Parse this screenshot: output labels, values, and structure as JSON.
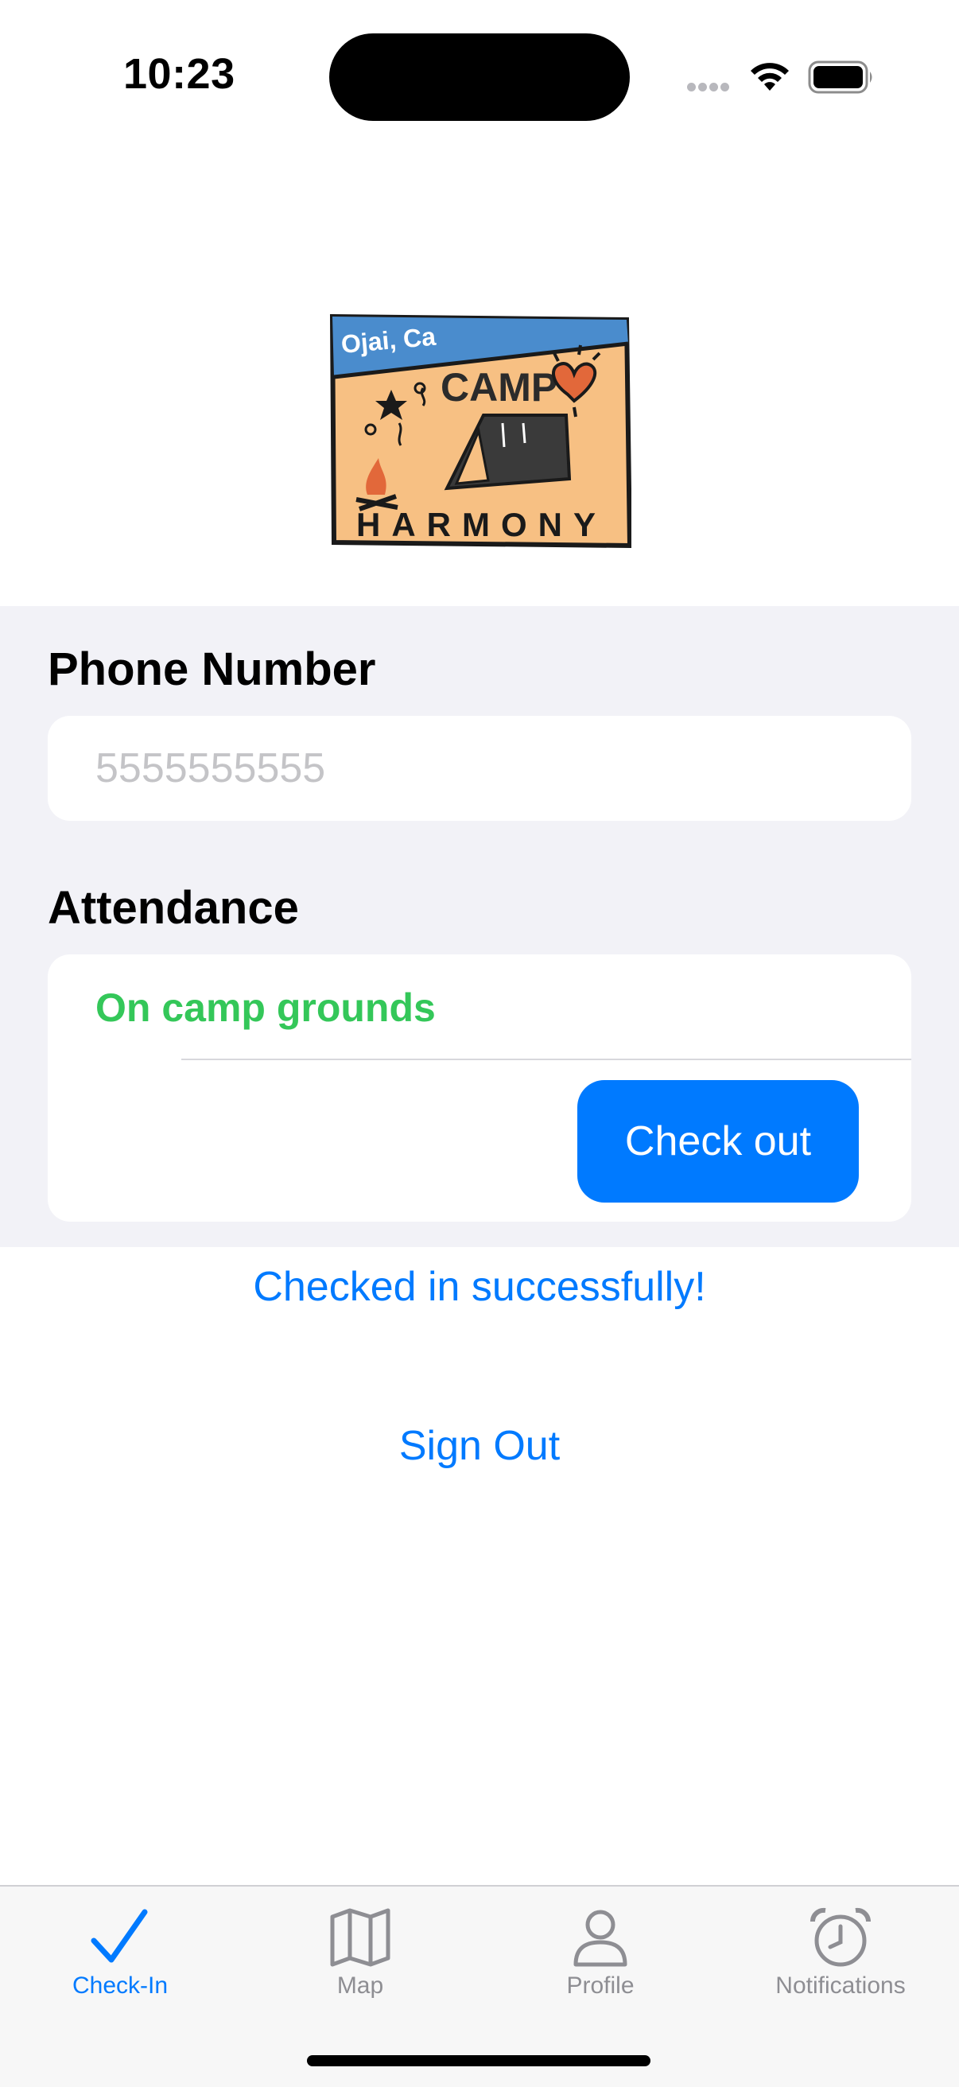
{
  "status_bar": {
    "time": "10:23"
  },
  "logo": {
    "text_top": "Ojai, Ca",
    "text_mid": "CAMP",
    "text_bottom": "HARMONY"
  },
  "form": {
    "phone_label": "Phone Number",
    "phone_placeholder": "5555555555",
    "phone_value": "",
    "attendance_label": "Attendance",
    "attendance_status": "On camp grounds",
    "checkout_label": "Check out"
  },
  "messages": {
    "success": "Checked in successfully!"
  },
  "actions": {
    "sign_out": "Sign Out"
  },
  "tabs": [
    {
      "label": "Check-In",
      "icon": "checkmark-icon",
      "active": true
    },
    {
      "label": "Map",
      "icon": "map-icon",
      "active": false
    },
    {
      "label": "Profile",
      "icon": "person-icon",
      "active": false
    },
    {
      "label": "Notifications",
      "icon": "alarm-clock-icon",
      "active": false
    }
  ],
  "colors": {
    "accent": "#007aff",
    "status_green": "#34c759",
    "grouped_bg": "#f2f2f7"
  }
}
